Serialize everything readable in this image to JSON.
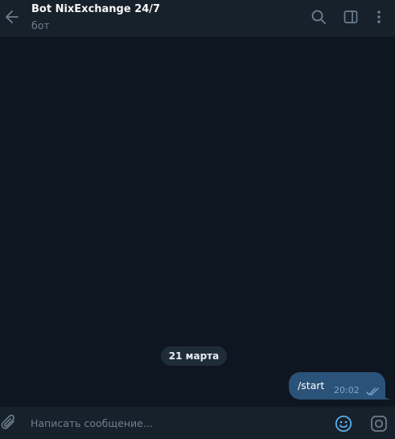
{
  "header": {
    "title": "Bot NixExchange 24/7",
    "subtitle": "бот"
  },
  "chat": {
    "date_label": "21 марта",
    "messages": [
      {
        "text": "/start",
        "time": "20:02",
        "direction": "outgoing",
        "status": "read"
      }
    ]
  },
  "composer": {
    "placeholder": "Написать сообщение..."
  },
  "icons": {
    "back": "arrow-left-icon",
    "search": "search-icon",
    "panel": "sidebar-panel-icon",
    "more": "more-vertical-icon",
    "attach": "paperclip-icon",
    "emoji": "emoji-icon",
    "camera": "camera-icon",
    "read": "double-check-icon"
  },
  "colors": {
    "background": "#0e1621",
    "header_bg": "#17212b",
    "bubble_out": "#2b5278",
    "accent": "#5eb5f7",
    "muted": "#6d7f8f"
  }
}
